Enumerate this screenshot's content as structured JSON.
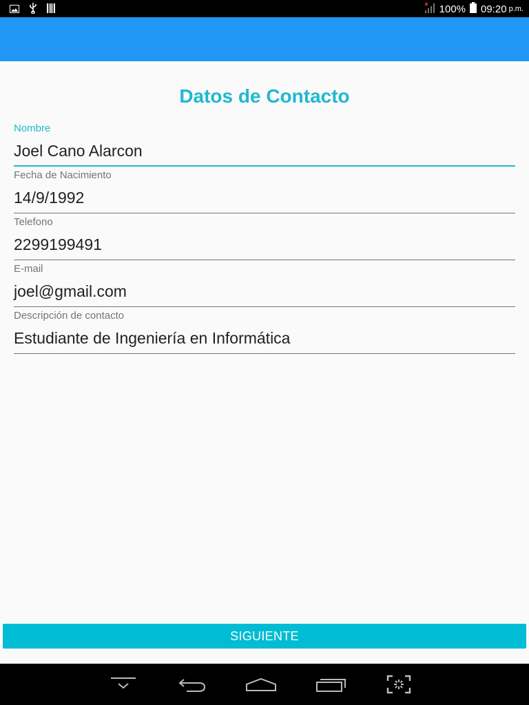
{
  "status_bar": {
    "icons_left": [
      "image-icon",
      "usb-icon",
      "barcode-icon"
    ],
    "battery": "100%",
    "time": "09:20",
    "ampm": "p.m."
  },
  "form": {
    "title": "Datos de Contacto",
    "fields": [
      {
        "label": "Nombre",
        "value": "Joel Cano Alarcon",
        "focused": true
      },
      {
        "label": "Fecha de Nacimiento",
        "value": "14/9/1992",
        "focused": false
      },
      {
        "label": "Telefono",
        "value": "2299199491",
        "focused": false
      },
      {
        "label": "E-mail",
        "value": "joel@gmail.com",
        "focused": false
      },
      {
        "label": "Descripción de contacto",
        "value": "Estudiante de Ingeniería en Informática",
        "focused": false
      }
    ],
    "submit_label": "SIGUIENTE"
  },
  "nav_bar": {
    "icons": [
      "hide-keyboard-icon",
      "back-icon",
      "home-icon",
      "recent-apps-icon",
      "screenshot-icon"
    ]
  },
  "colors": {
    "app_bar": "#2196f3",
    "accent": "#1fb8cf",
    "button": "#00bcd4"
  }
}
